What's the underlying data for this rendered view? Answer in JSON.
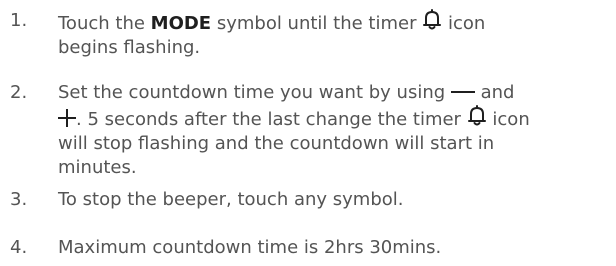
{
  "steps": [
    {
      "number": "1.",
      "line1_before_bold": "Touch the ",
      "bold": "MODE",
      "line1_after_bold": " symbol until the timer ",
      "line1_after_icon": " icon",
      "line2": "begins flashing."
    },
    {
      "number": "2.",
      "line1_before_minus": "Set the countdown time you want by using ",
      "line1_after_minus": " and",
      "line2_after_plus": ". 5 seconds after the last change the timer ",
      "line2_after_icon": " icon",
      "line3": "will stop flashing and the countdown will start in",
      "line4": "minutes."
    },
    {
      "number": "3.",
      "line1": "To stop the beeper, touch any symbol."
    },
    {
      "number": "4.",
      "line1": "Maximum countdown time is 2hrs 30mins."
    }
  ],
  "icons": {
    "timer": "bell-icon",
    "minus": "minus-icon",
    "plus": "plus-icon"
  },
  "colors": {
    "text": "#545454",
    "emphasis": "#1f1f1f"
  }
}
